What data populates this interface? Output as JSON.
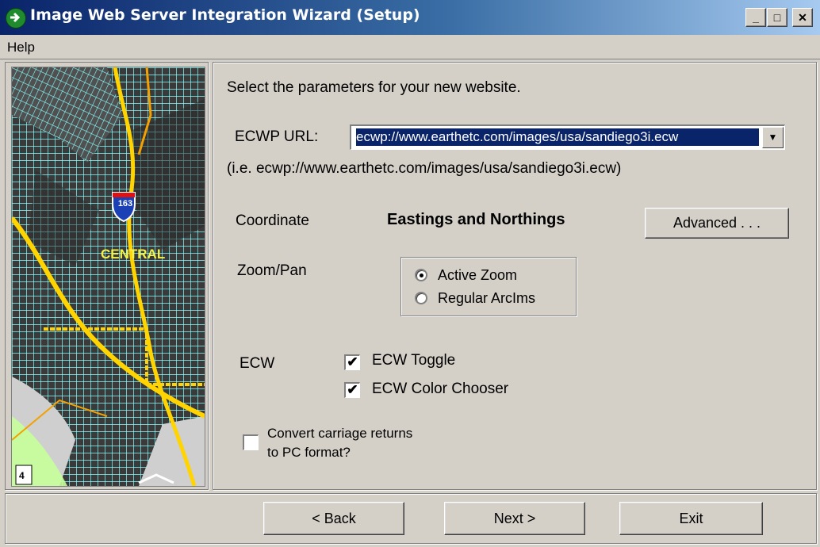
{
  "window": {
    "title": "Image Web Server Integration Wizard (Setup)",
    "controls": {
      "minimize": "_",
      "maximize": "□",
      "close": "✕"
    }
  },
  "menu": {
    "help": "Help"
  },
  "map": {
    "highway_shield": "163",
    "area_label": "CENTRAL",
    "route_shield": "4"
  },
  "content": {
    "instruction": "Select the parameters for your new website.",
    "ecwp_url": {
      "label": "ECWP URL:",
      "value": "ecwp://www.earthetc.com/images/usa/sandiego3i.ecw",
      "hint": "(i.e. ecwp://www.earthetc.com/images/usa/sandiego3i.ecw)"
    },
    "coordinate": {
      "label": "Coordinate",
      "value": "Eastings and Northings",
      "advanced_button": "Advanced . . ."
    },
    "zoom_pan": {
      "label": "Zoom/Pan",
      "options": [
        {
          "label": "Active Zoom",
          "selected": true
        },
        {
          "label": "Regular ArcIms",
          "selected": false
        }
      ]
    },
    "ecw": {
      "label": "ECW",
      "options": [
        {
          "label": "ECW Toggle",
          "checked": true
        },
        {
          "label": "ECW Color Chooser",
          "checked": true
        }
      ]
    },
    "convert": {
      "line1": "Convert carriage returns",
      "line2": "to PC format?",
      "checked": false
    }
  },
  "footer": {
    "back": "< Back",
    "next": "Next >",
    "exit": "Exit"
  },
  "colors": {
    "titlebar_start": "#0a246a",
    "titlebar_end": "#a6caf0",
    "face": "#d4d0c8",
    "selection": "#0a246a"
  }
}
